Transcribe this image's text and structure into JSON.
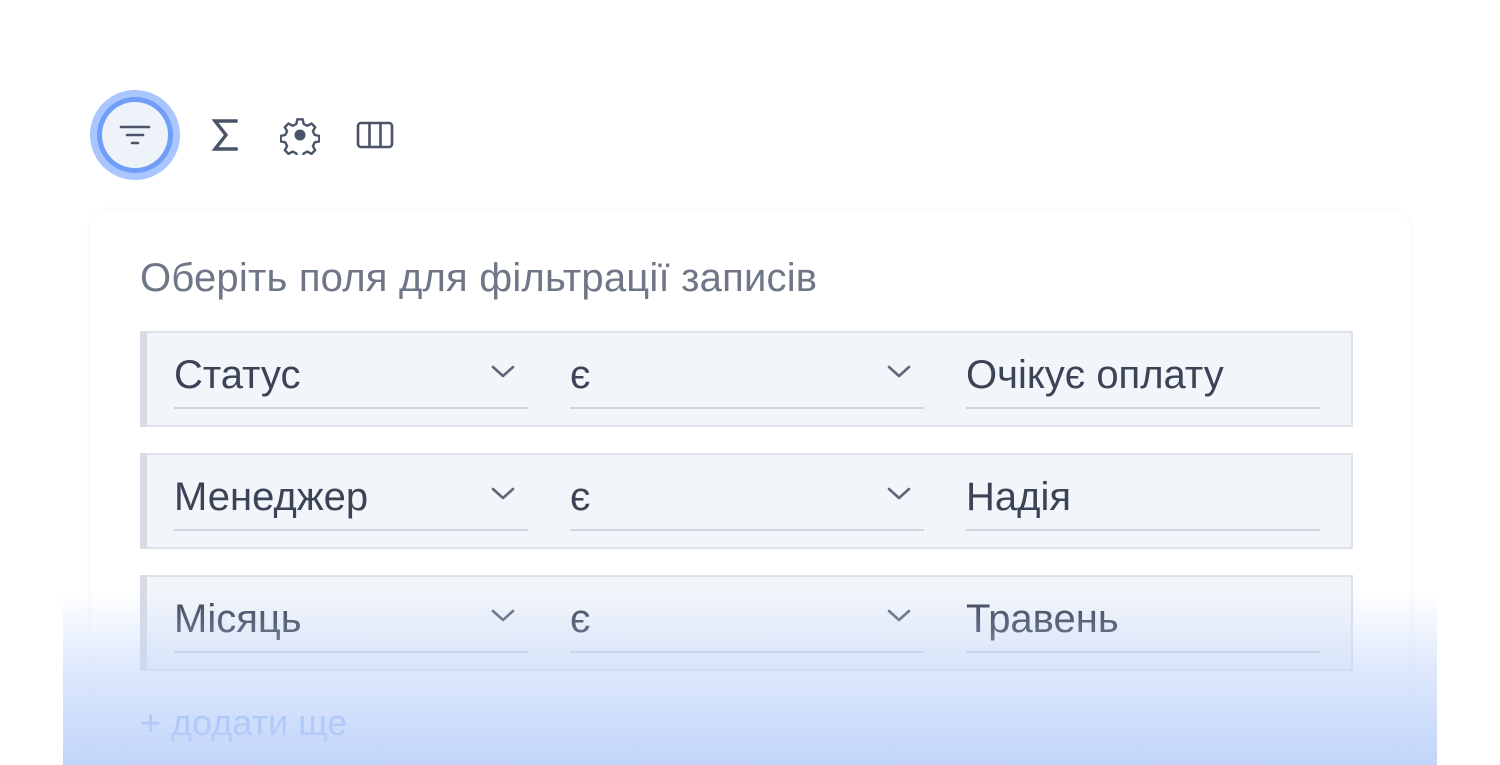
{
  "toolbar": {
    "filter_icon": "filter-lines-icon",
    "sum_icon": "sigma-icon",
    "settings_icon": "gear-icon",
    "columns_icon": "columns-icon"
  },
  "panel": {
    "title": "Оберіть поля для фільтрації записів",
    "add_more": "+ додати ще",
    "filters": [
      {
        "field": "Статус",
        "operator": "є",
        "value": "Очікує оплату"
      },
      {
        "field": "Менеджер",
        "operator": "є",
        "value": "Надія"
      },
      {
        "field": "Місяць",
        "operator": "є",
        "value": "Травень"
      }
    ]
  },
  "colors": {
    "accent": "#6f9ff8",
    "accent_halo": "#a9c6ff",
    "text": "#3b4356",
    "muted_text": "#6e7688",
    "row_bg": "#f2f5fa",
    "link": "#7aa7f4"
  }
}
